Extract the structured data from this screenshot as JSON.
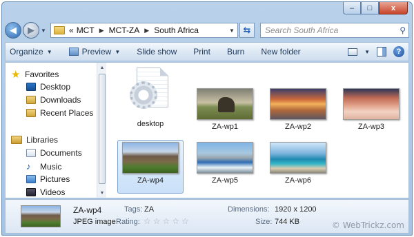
{
  "window": {
    "caption": {
      "minimize": "–",
      "maximize": "□",
      "close": "x"
    }
  },
  "address": {
    "prefix": "«",
    "crumbs": [
      "MCT",
      "MCT-ZA",
      "South Africa"
    ],
    "search_placeholder": "Search South Africa"
  },
  "toolbar": {
    "organize": "Organize",
    "preview": "Preview",
    "slideshow": "Slide show",
    "print": "Print",
    "burn": "Burn",
    "new_folder": "New folder",
    "help": "?"
  },
  "nav": {
    "favorites": "Favorites",
    "desktop": "Desktop",
    "downloads": "Downloads",
    "recent": "Recent Places",
    "libraries": "Libraries",
    "documents": "Documents",
    "music": "Music",
    "pictures": "Pictures",
    "videos": "Videos"
  },
  "files": [
    {
      "name": "desktop",
      "type": "ini"
    },
    {
      "name": "ZA-wp1",
      "type": "image"
    },
    {
      "name": "ZA-wp2",
      "type": "image"
    },
    {
      "name": "ZA-wp3",
      "type": "image"
    },
    {
      "name": "ZA-wp4",
      "type": "image",
      "selected": true
    },
    {
      "name": "ZA-wp5",
      "type": "image"
    },
    {
      "name": "ZA-wp6",
      "type": "image"
    }
  ],
  "details": {
    "name": "ZA-wp4",
    "type": "JPEG image",
    "tags_label": "Tags:",
    "tags_value": "ZA",
    "rating_label": "Rating:",
    "rating_stars": "☆☆☆☆☆",
    "dimensions_label": "Dimensions:",
    "dimensions_value": "1920 x 1200",
    "size_label": "Size:",
    "size_value": "744 KB"
  },
  "watermark": "© WebTrickz.com",
  "colors": {
    "chrome": "#b9d1ea",
    "selection": "#c9e0f8",
    "accent": "#1d5fb5"
  }
}
